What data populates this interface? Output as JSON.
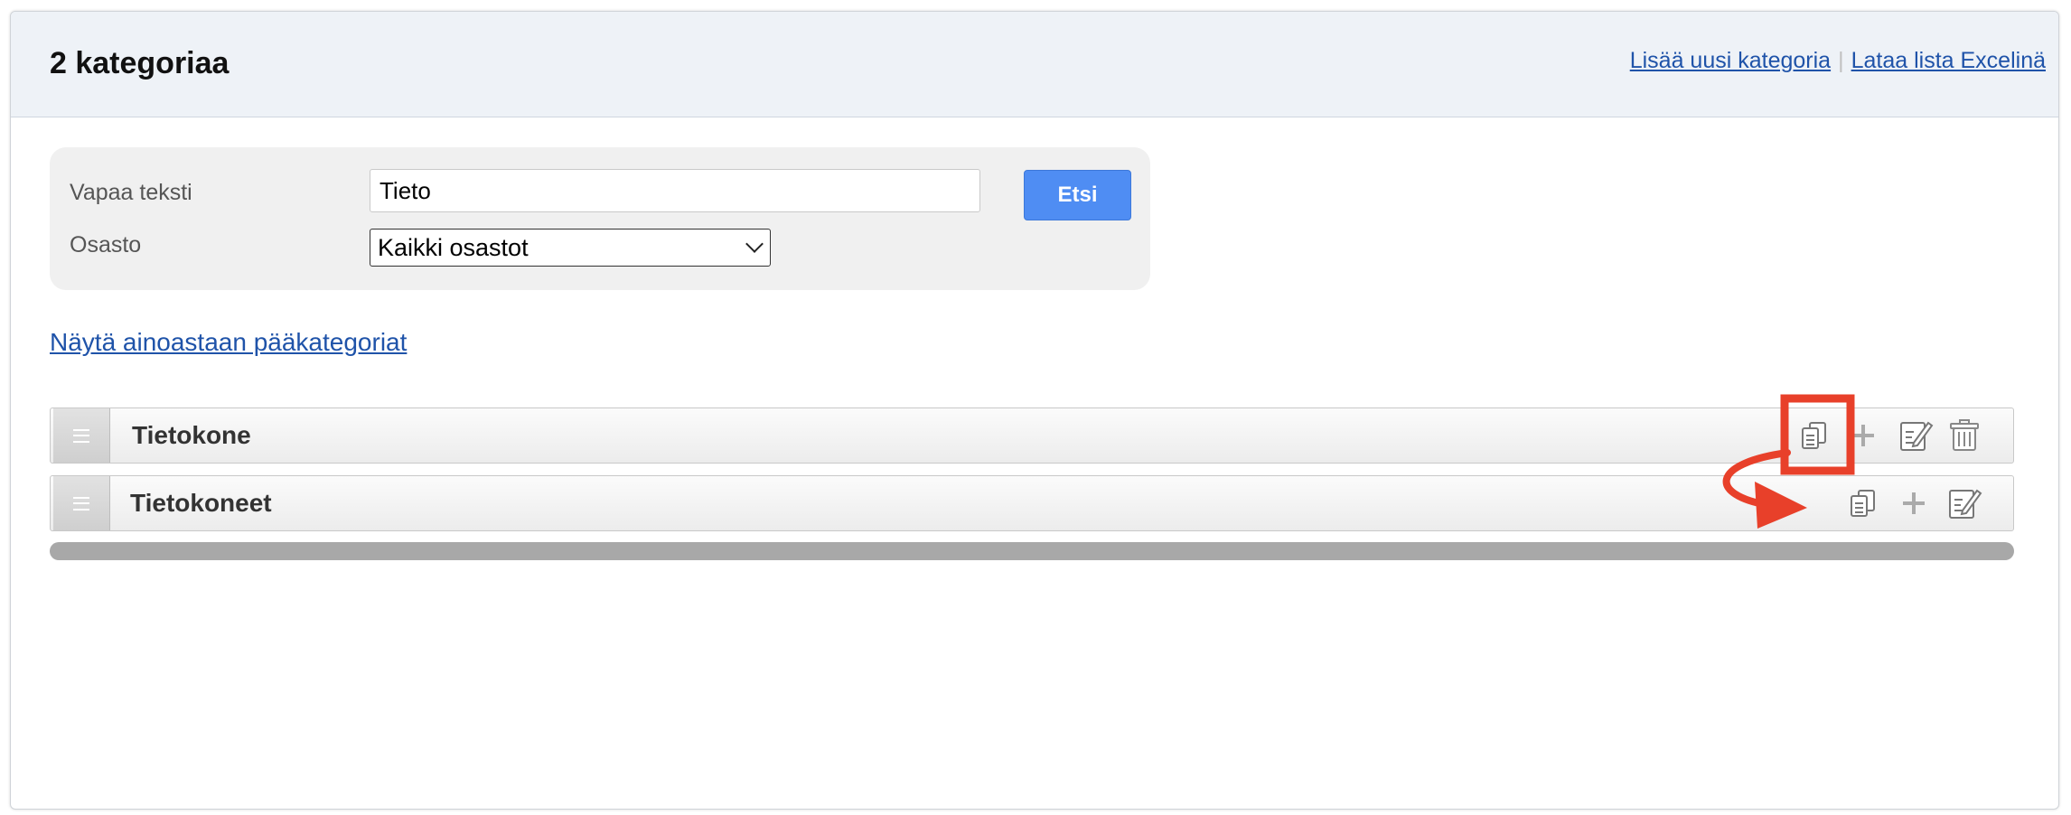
{
  "header": {
    "title": "2 kategoriaa",
    "links": [
      "Lisää uusi kategoria",
      "Lataa lista Excelinä"
    ],
    "separator": "|"
  },
  "search": {
    "free_text_label": "Vapaa teksti",
    "free_text_value": "Tieto",
    "department_label": "Osasto",
    "department_value": "Kaikki osastot",
    "search_button": "Etsi"
  },
  "filter_link": "Näytä ainoastaan pääkategoriat",
  "categories": [
    {
      "name": "Tietokone",
      "actions": [
        "copy-icon",
        "plus-icon",
        "edit-icon",
        "trash-icon"
      ]
    },
    {
      "name": "Tietokoneet",
      "actions": [
        "copy-icon",
        "plus-icon",
        "edit-icon"
      ]
    }
  ],
  "annotation": {
    "highlight_color": "#e8402a"
  }
}
